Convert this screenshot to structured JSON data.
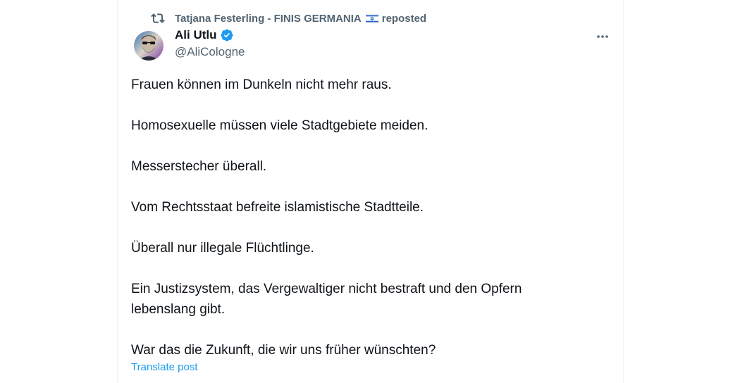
{
  "repost": {
    "user": "Tatjana Festerling - FINIS GERMANIA",
    "suffix": "reposted",
    "icon": "repost-icon",
    "flag_icon": "israel-flag-icon"
  },
  "author": {
    "display_name": "Ali Utlu",
    "handle": "@AliCologne",
    "verified": true,
    "verified_color": "#1d9bf0"
  },
  "post": {
    "lines": [
      "Frauen können im Dunkeln nicht mehr raus.",
      "Homosexuelle müssen viele Stadtgebiete meiden.",
      "Messerstecher überall.",
      "Vom Rechtsstaat befreite islamistische Stadtteile.",
      "Überall nur illegale Flüchtlinge.",
      "Ein Justizsystem, das Vergewaltiger nicht bestraft und den Opfern lebenslang gibt.",
      "War das die Zukunft, die wir uns früher wünschten?"
    ],
    "translate_label": "Translate post"
  },
  "colors": {
    "text": "#0f1419",
    "secondary": "#536471",
    "link": "#1d9bf0",
    "border": "#eff3f4"
  }
}
